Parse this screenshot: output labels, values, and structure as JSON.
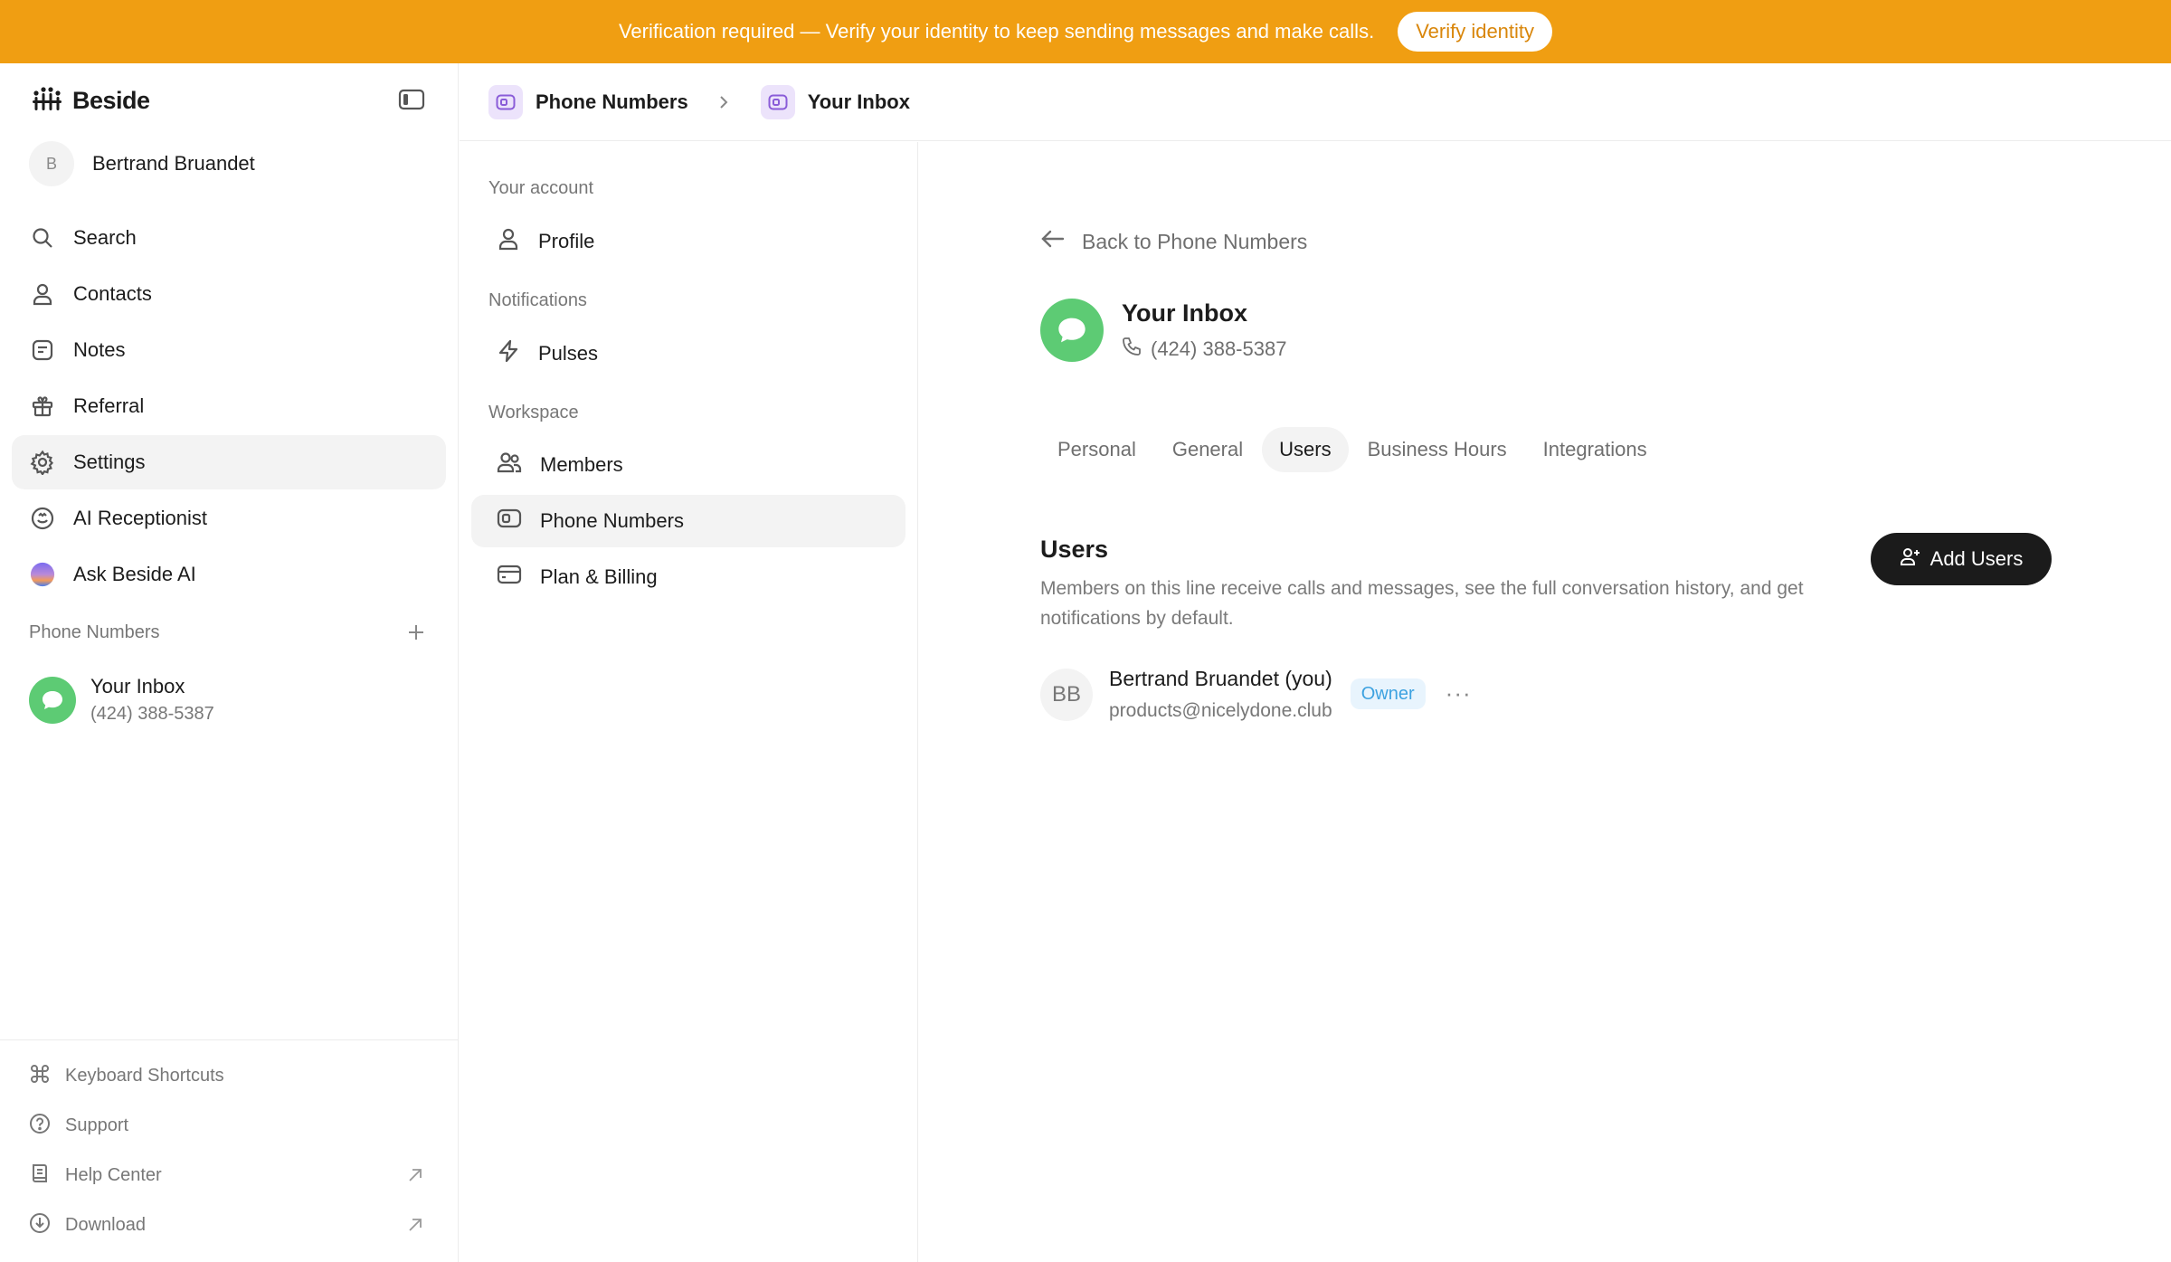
{
  "banner": {
    "text": "Verification required — Verify your identity to keep sending messages and make calls.",
    "button": "Verify identity"
  },
  "sidebar": {
    "brand": "Beside",
    "user": {
      "initial": "B",
      "name": "Bertrand Bruandet"
    },
    "nav": [
      {
        "label": "Search",
        "icon": "search-icon"
      },
      {
        "label": "Contacts",
        "icon": "person-icon"
      },
      {
        "label": "Notes",
        "icon": "note-icon"
      },
      {
        "label": "Referral",
        "icon": "gift-icon"
      },
      {
        "label": "Settings",
        "icon": "gear-icon",
        "active": true
      },
      {
        "label": "AI Receptionist",
        "icon": "receptionist-icon"
      },
      {
        "label": "Ask Beside AI",
        "icon": "ai-orb-icon"
      }
    ],
    "phone_section": "Phone Numbers",
    "phone_item": {
      "title": "Your Inbox",
      "number": "(424) 388-5387"
    },
    "footer": [
      {
        "label": "Keyboard Shortcuts",
        "icon": "command-icon"
      },
      {
        "label": "Support",
        "icon": "question-icon"
      },
      {
        "label": "Help Center",
        "icon": "book-icon",
        "external": true
      },
      {
        "label": "Download",
        "icon": "download-icon",
        "external": true
      }
    ]
  },
  "breadcrumb": [
    "Phone Numbers",
    "Your Inbox"
  ],
  "settings": {
    "sections": [
      {
        "label": "Your account",
        "items": [
          {
            "label": "Profile",
            "icon": "person-icon"
          }
        ]
      },
      {
        "label": "Notifications",
        "items": [
          {
            "label": "Pulses",
            "icon": "bolt-icon"
          }
        ]
      },
      {
        "label": "Workspace",
        "items": [
          {
            "label": "Members",
            "icon": "members-icon"
          },
          {
            "label": "Phone Numbers",
            "icon": "phone-card-icon",
            "active": true
          },
          {
            "label": "Plan & Billing",
            "icon": "card-icon"
          }
        ]
      }
    ]
  },
  "main": {
    "back": "Back to Phone Numbers",
    "inbox_title": "Your Inbox",
    "inbox_phone": "(424) 388-5387",
    "tabs": [
      "Personal",
      "General",
      "Users",
      "Business Hours",
      "Integrations"
    ],
    "active_tab": "Users",
    "users_title": "Users",
    "users_desc": "Members on this line receive calls and messages, see the full conversation history, and get notifications by default.",
    "add_button": "Add Users",
    "member": {
      "initials": "BB",
      "name": "Bertrand Bruandet (you)",
      "email": "products@nicelydone.club",
      "role": "Owner",
      "more": "···"
    }
  },
  "colors": {
    "banner": "#f09e12",
    "inbox_green": "#5dcb74",
    "owner_badge": "#3da2e0",
    "dark_button": "#1b1b1b"
  }
}
